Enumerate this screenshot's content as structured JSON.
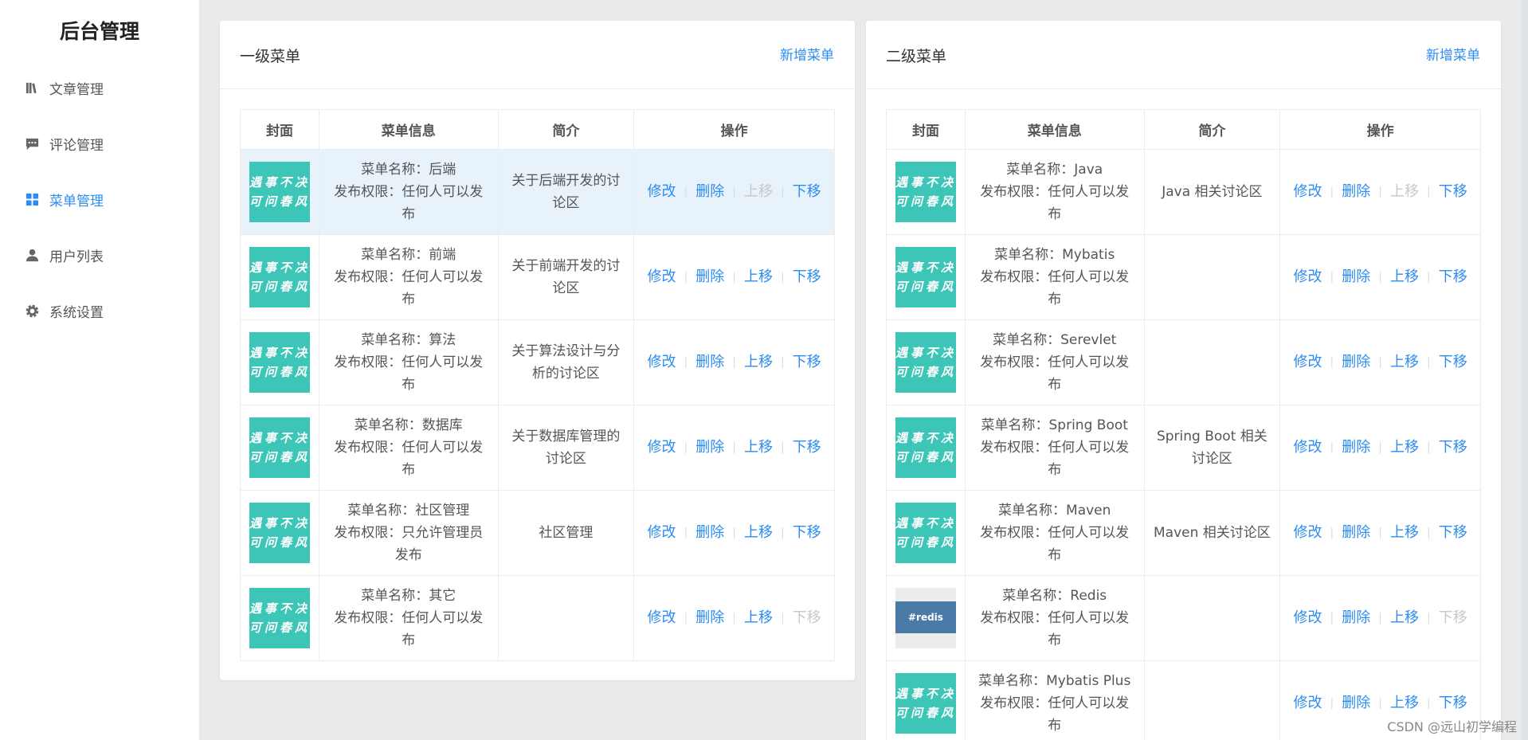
{
  "sidebar": {
    "brand": "后台管理",
    "items": [
      {
        "label": "文章管理",
        "icon": "book-icon",
        "active": false
      },
      {
        "label": "评论管理",
        "icon": "comment-icon",
        "active": false
      },
      {
        "label": "菜单管理",
        "icon": "grid-icon",
        "active": true
      },
      {
        "label": "用户列表",
        "icon": "user-icon",
        "active": false
      },
      {
        "label": "系统设置",
        "icon": "gear-icon",
        "active": false
      }
    ]
  },
  "left_panel": {
    "title": "一级菜单",
    "action": "新增菜单",
    "columns": [
      "封面",
      "菜单信息",
      "简介",
      "操作"
    ],
    "rows": [
      {
        "name": "菜单名称：后端",
        "perm_a": "发布权限：任何人可以发",
        "perm_b": "布",
        "intro": "关于后端开发的讨论区",
        "up_disabled": true,
        "down_disabled": false,
        "highlight": true
      },
      {
        "name": "菜单名称：前端",
        "perm_a": "发布权限：任何人可以发",
        "perm_b": "布",
        "intro": "关于前端开发的讨论区",
        "up_disabled": false,
        "down_disabled": false,
        "highlight": false
      },
      {
        "name": "菜单名称：算法",
        "perm_a": "发布权限：任何人可以发",
        "perm_b": "布",
        "intro": "关于算法设计与分析的讨论区",
        "up_disabled": false,
        "down_disabled": false,
        "highlight": false
      },
      {
        "name": "菜单名称：数据库",
        "perm_a": "发布权限：任何人可以发",
        "perm_b": "布",
        "intro": "关于数据库管理的讨论区",
        "up_disabled": false,
        "down_disabled": false,
        "highlight": false
      },
      {
        "name": "菜单名称：社区管理",
        "perm_a": "发布权限：只允许管理员",
        "perm_b": "发布",
        "intro": "社区管理",
        "up_disabled": false,
        "down_disabled": false,
        "highlight": false
      },
      {
        "name": "菜单名称：其它",
        "perm_a": "发布权限：任何人可以发",
        "perm_b": "布",
        "intro": "",
        "up_disabled": false,
        "down_disabled": true,
        "highlight": false
      }
    ]
  },
  "right_panel": {
    "title": "二级菜单",
    "action": "新增菜单",
    "columns": [
      "封面",
      "菜单信息",
      "简介",
      "操作"
    ],
    "rows": [
      {
        "name": "菜单名称：Java",
        "perm_a": "发布权限：任何人可以发",
        "perm_b": "布",
        "intro": "Java 相关讨论区",
        "up_disabled": true,
        "down_disabled": false,
        "cover": "default"
      },
      {
        "name": "菜单名称：Mybatis",
        "perm_a": "发布权限：任何人可以发",
        "perm_b": "布",
        "intro": "",
        "up_disabled": false,
        "down_disabled": false,
        "cover": "default"
      },
      {
        "name": "菜单名称：Serevlet",
        "perm_a": "发布权限：任何人可以发",
        "perm_b": "布",
        "intro": "",
        "up_disabled": false,
        "down_disabled": false,
        "cover": "default"
      },
      {
        "name": "菜单名称：Spring Boot",
        "perm_a": "发布权限：任何人可以发",
        "perm_b": "布",
        "intro": "Spring Boot 相关讨论区",
        "up_disabled": false,
        "down_disabled": false,
        "cover": "default"
      },
      {
        "name": "菜单名称：Maven",
        "perm_a": "发布权限：任何人可以发",
        "perm_b": "布",
        "intro": "Maven 相关讨论区",
        "up_disabled": false,
        "down_disabled": false,
        "cover": "default"
      },
      {
        "name": "菜单名称：Redis",
        "perm_a": "发布权限：任何人可以发",
        "perm_b": "布",
        "intro": "",
        "up_disabled": false,
        "down_disabled": true,
        "cover": "redis"
      },
      {
        "name": "菜单名称：Mybatis Plus",
        "perm_a": "发布权限：任何人可以发",
        "perm_b": "布",
        "intro": "",
        "up_disabled": false,
        "down_disabled": false,
        "cover": "default"
      }
    ]
  },
  "cover_text": {
    "line1": "遇事不决",
    "line2": "可问春风"
  },
  "redis_cover_text": "#redis",
  "ops": {
    "edit": "修改",
    "delete": "删除",
    "up": "上移",
    "down": "下移"
  },
  "watermark": "CSDN @远山初学编程",
  "colors": {
    "accent": "#2d8cf0",
    "cover": "#3dc6b8",
    "highlight_row": "#e8f2fb",
    "disabled": "#c8c8c8"
  }
}
